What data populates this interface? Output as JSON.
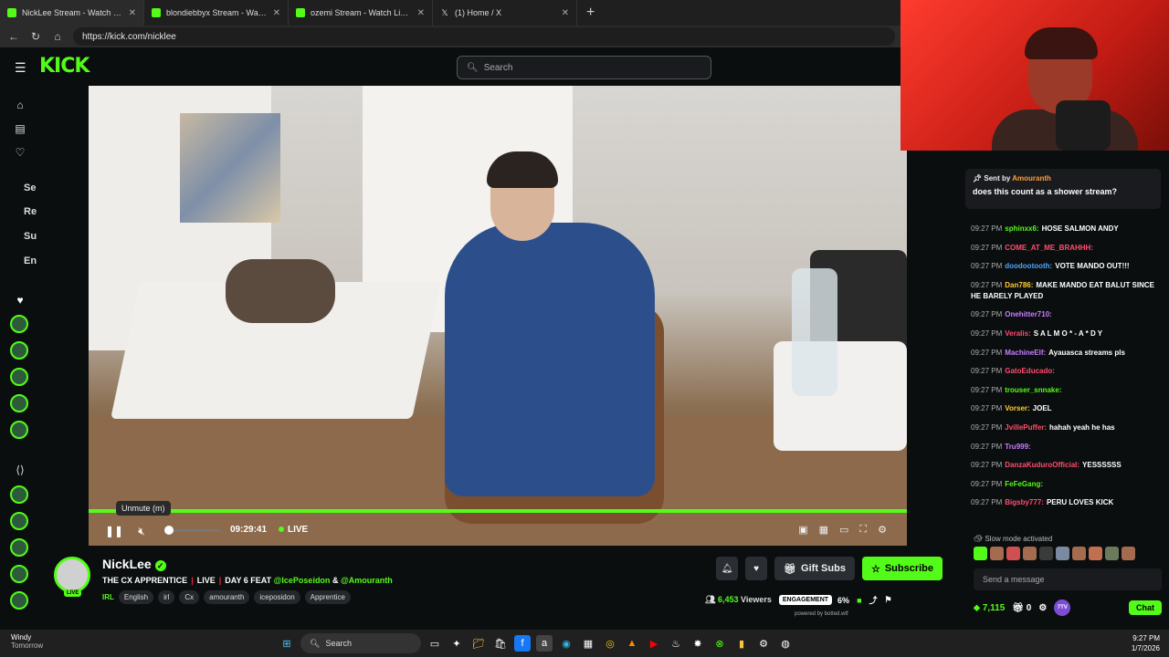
{
  "browser": {
    "tabs": [
      {
        "title": "NickLee Stream - Watch Live"
      },
      {
        "title": "blondiebbyx Stream - Watch"
      },
      {
        "title": "ozemi Stream - Watch Live on"
      },
      {
        "title": "(1) Home / X"
      }
    ],
    "url": "https://kick.com/nicklee"
  },
  "header": {
    "logo": "KICK",
    "search_placeholder": "Search"
  },
  "sidebar": {
    "items": [
      "Se",
      "Re",
      "Su",
      "En"
    ]
  },
  "player": {
    "tooltip": "Unmute (m)",
    "time": "09:29:41",
    "live": "LIVE",
    "progress": 1.0
  },
  "channel": {
    "name": "NickLee",
    "live_badge": "LIVE",
    "title_parts": [
      "THE CX APPRENTICE",
      "LIVE",
      "DAY 6 FEAT",
      "@IcePoseidon",
      "&",
      "@Amouranth"
    ],
    "tags": [
      "IRL",
      "English",
      "irl",
      "Cx",
      "amouranth",
      "iceposidon",
      "Apprentice"
    ],
    "gift_label": "Gift Subs",
    "subscribe_label": "Subscribe",
    "viewers_count": "6,453",
    "viewers_label": "Viewers",
    "engagement_label": "ENGAGEMENT",
    "engagement_pct": "6%",
    "powered_by": "powered by botted.wtf"
  },
  "chat": {
    "pinned_prefix": "Sent by",
    "pinned_user": "Amouranth",
    "pinned_message": "does this count as a shower stream?",
    "messages": [
      {
        "time": "09:27 PM",
        "user": "sphinxx6:",
        "color": "#53fc18",
        "text": "HOSE SALMON ANDY"
      },
      {
        "time": "09:27 PM",
        "user": "COME_AT_ME_BRAHHH:",
        "color": "#ff4d6d",
        "text": ""
      },
      {
        "time": "09:27 PM",
        "user": "doodootooth:",
        "color": "#4da6ff",
        "text": "VOTE MANDO OUT!!!"
      },
      {
        "time": "09:27 PM",
        "user": "Dan786:",
        "color": "#ffcc33",
        "text": "MAKE MANDO EAT BALUT SINCE HE BARELY PLAYED"
      },
      {
        "time": "09:27 PM",
        "user": "Onehitter710:",
        "color": "#c77dff",
        "text": ""
      },
      {
        "time": "09:27 PM",
        "user": "Veralis:",
        "color": "#ff4d6d",
        "text": "S A L M O * - A * D Y"
      },
      {
        "time": "09:27 PM",
        "user": "MachineElf:",
        "color": "#c77dff",
        "text": "Ayauasca streams pls"
      },
      {
        "time": "09:27 PM",
        "user": "GatoEducado:",
        "color": "#ff4d6d",
        "text": ""
      },
      {
        "time": "09:27 PM",
        "user": "trouser_snnake:",
        "color": "#53fc18",
        "text": ""
      },
      {
        "time": "09:27 PM",
        "user": "Vorser:",
        "color": "#ffcc33",
        "text": "JOEL"
      },
      {
        "time": "09:27 PM",
        "user": "JvillePuffer:",
        "color": "#ff4d6d",
        "text": "hahah yeah he has"
      },
      {
        "time": "09:27 PM",
        "user": "Tru999:",
        "color": "#c77dff",
        "text": ""
      },
      {
        "time": "09:27 PM",
        "user": "DanzaKuduroOfficial:",
        "color": "#ff4d6d",
        "text": "YESSSSSS"
      },
      {
        "time": "09:27 PM",
        "user": "FeFeGang:",
        "color": "#53fc18",
        "text": ""
      },
      {
        "time": "09:27 PM",
        "user": "Bigsby777:",
        "color": "#ff4d6d",
        "text": "PERU LOVES KICK"
      }
    ],
    "slow_mode": "Slow mode activated",
    "send_placeholder": "Send a message",
    "points": "7,115",
    "zero": "0",
    "chat_button": "Chat",
    "badge_7tv": "7TV"
  },
  "taskbar": {
    "weather": "Windy",
    "weather_sub": "Tomorrow",
    "search": "Search",
    "time": "9:27 PM",
    "date": "1/7/2026"
  }
}
